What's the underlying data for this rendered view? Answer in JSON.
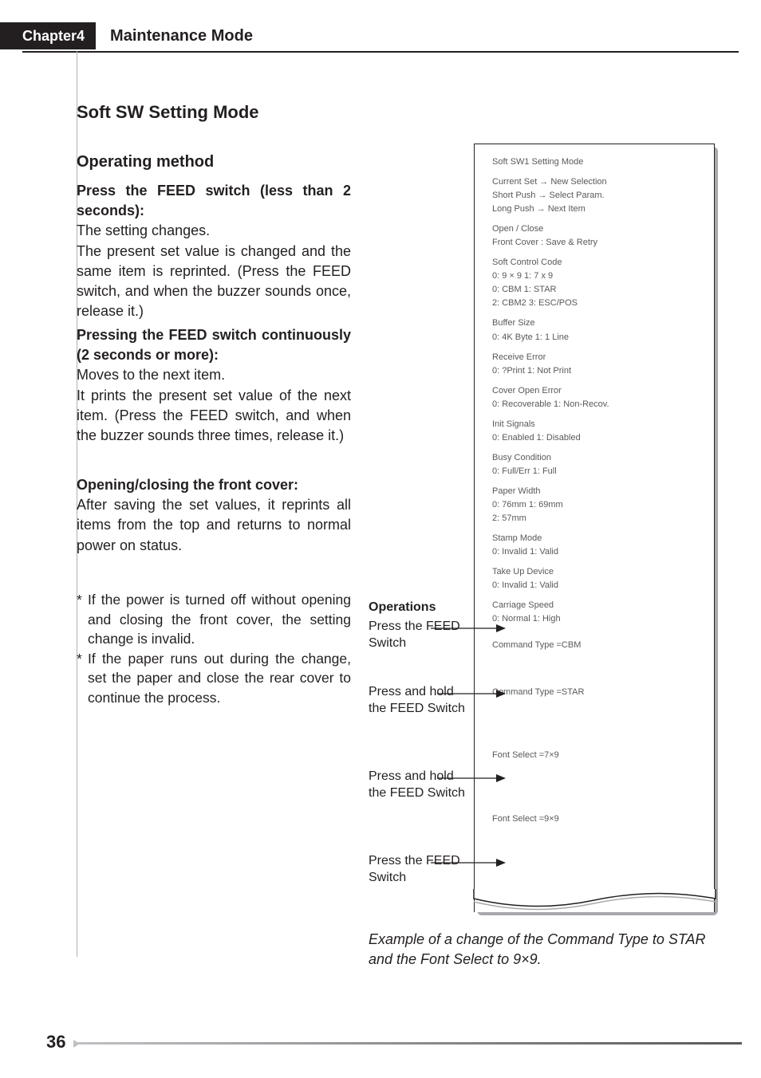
{
  "header": {
    "chapter": "Chapter4",
    "title": "Maintenance Mode"
  },
  "h2": "Soft SW Setting Mode",
  "h3": "Operating method",
  "b1": {
    "lead": "Press the FEED switch (less than 2 seconds):",
    "l1": "The setting changes.",
    "l2": "The present set value is changed and the same item is reprinted. (Press the FEED switch, and when the buzzer sounds once, release it.)"
  },
  "b2": {
    "lead": "Pressing the FEED switch continuously (2 seconds or more):",
    "l1": "Moves to the next item.",
    "l2": "It prints the present set value of the next item. (Press the FEED switch, and when the buzzer sounds three times, release it.)"
  },
  "b3": {
    "lead": "Opening/closing the front cover:",
    "l1": "After saving the set values, it reprints all items from the top and returns to normal power on status."
  },
  "b4": {
    "n1": "If the power is turned off without opening and closing the front cover, the setting change is invalid.",
    "n2": "If the paper runs out during the change, set the paper and close the rear cover to continue the process."
  },
  "receipt": {
    "l1": "          Soft SW1 Setting Mode",
    "l2": "       Current Set → New Selection",
    "l3": "        Short Push → Select Param.",
    "l4": "        Long  Push → Next  Item",
    "l5": "           Open / Close",
    "l6": "        Front Cover : Save & Retry",
    "l7": "           Soft Control Code",
    "l8": "          0: 9 × 9          1: 7 x 9",
    "l9": "          0: CBM           1: STAR",
    "l10": "          2: CBM2          3: ESC/POS",
    "l11": "           Buffer Size",
    "l12": "          0: 4K Byte       1: 1 Line",
    "l13": "           Receive Error",
    "l14": "          0: ?Print         1: Not Print",
    "l15": "           Cover Open Error",
    "l16": "          0: Recoverable    1: Non-Recov.",
    "l17": "           Init Signals",
    "l18": "          0: Enabled        1: Disabled",
    "l19": "           Busy Condition",
    "l20": "          0: Full/Err       1: Full",
    "l21": "           Paper Width",
    "l22": "          0: 76mm           1: 69mm",
    "l23": "          2: 57mm",
    "l24": "           Stamp Mode",
    "l25": "          0: Invalid        1: Valid",
    "l26": "           Take Up Device",
    "l27": "          0: Invalid        1: Valid",
    "l28": "           Carriage Speed",
    "l29": "          0: Normal         1: High",
    "l30": "Command Type            =CBM",
    "l31": "Command Type            =STAR",
    "l32": "Font Select             =7×9",
    "l33": "Font Select             =9×9"
  },
  "ops": {
    "title": "Operations",
    "o1": "Press the FEED Switch",
    "o2": "Press and hold the FEED Switch",
    "o3": "Press and hold the FEED Switch",
    "o4": "Press the FEED Switch"
  },
  "caption": "Example of a change of the Command Type to STAR and the Font Select to 9×9.",
  "pagenum": "36"
}
